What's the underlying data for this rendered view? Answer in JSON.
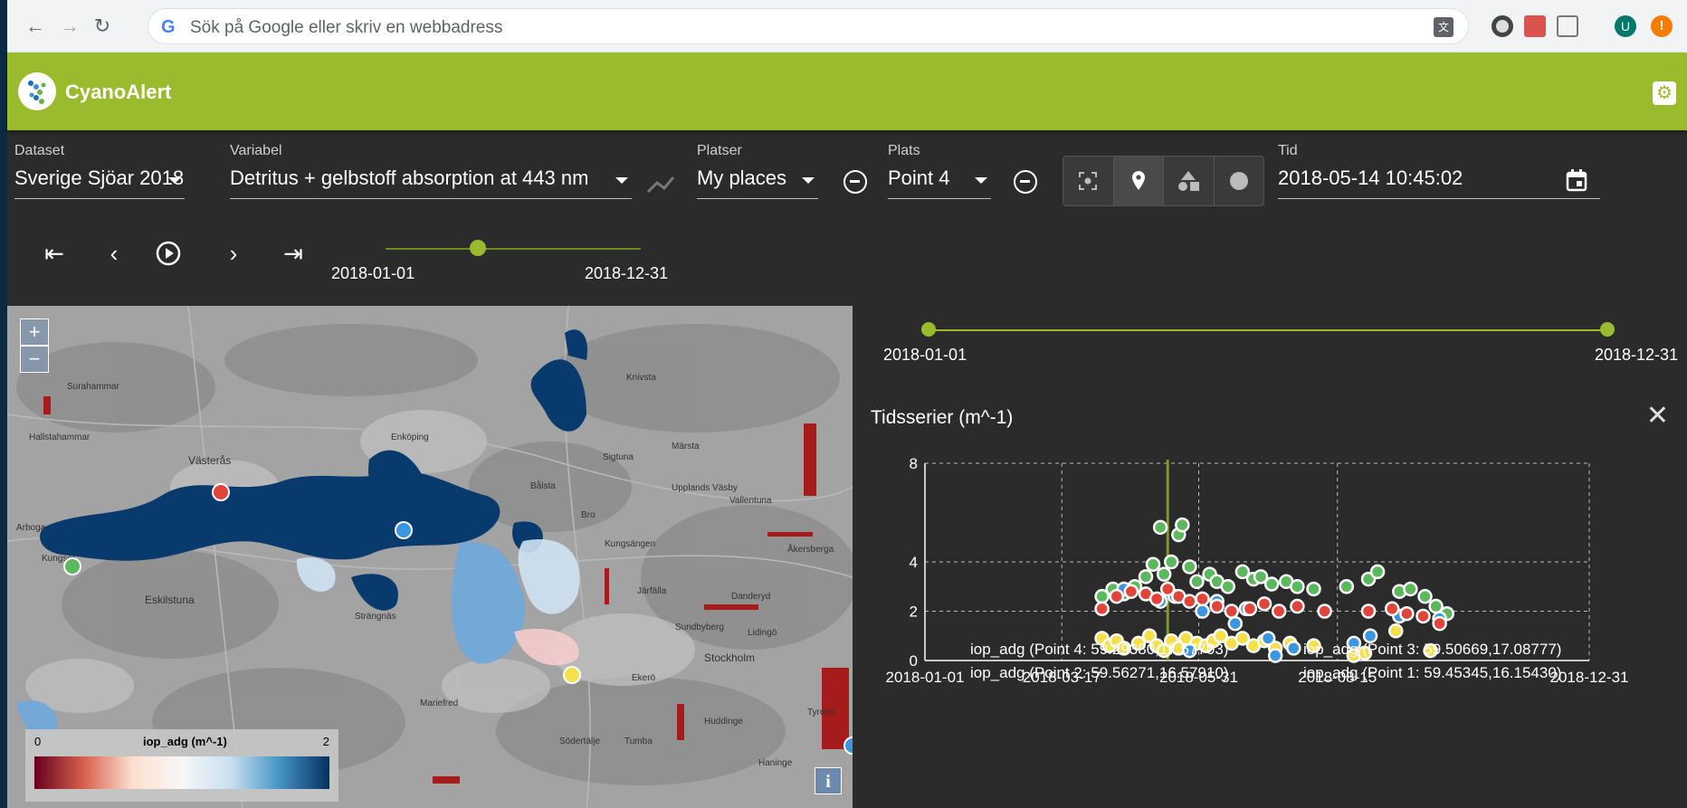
{
  "browser": {
    "omnibox_placeholder": "Sök på Google eller skriv en webbadress",
    "avatar_letter": "U"
  },
  "app": {
    "title": "CyanoAlert"
  },
  "controls": {
    "dataset": {
      "label": "Dataset",
      "value": "Sverige Sjöar 2018"
    },
    "variable": {
      "label": "Variabel",
      "value": "Detritus + gelbstoff absorption at 443 nm"
    },
    "places": {
      "label": "Platser",
      "value": "My places"
    },
    "place": {
      "label": "Plats",
      "value": "Point 4"
    },
    "time": {
      "label": "Tid",
      "value": "2018-05-14 10:45:02"
    },
    "toggle_icons": [
      "focus-icon",
      "pin-icon",
      "shapes-icon",
      "circle-icon"
    ]
  },
  "playback": {
    "start": "2018-01-01",
    "end": "2018-12-31",
    "position": 0.37
  },
  "map": {
    "places": [
      "Surahammar",
      "Hallstahammar",
      "Västerås",
      "Enköping",
      "Knivsta",
      "Märsta",
      "Sigtuna",
      "Bålsta",
      "Upplands Väsby",
      "Vallentuna",
      "Bro",
      "Kungsängen",
      "Järfälla",
      "Danderyd",
      "Åkersberga",
      "Kungsör",
      "Eskilstuna",
      "Strängnäs",
      "Sundbyberg",
      "Lidingö",
      "Stockholm",
      "Ekerö",
      "Mariefred",
      "Huddinge",
      "Tyresö",
      "Södertälje",
      "Tumba",
      "Haninge",
      "Arboga"
    ],
    "legend": {
      "min": "0",
      "max": "2",
      "name": "iop_adg (m^-1)"
    },
    "zoom_in": "+",
    "zoom_out": "−",
    "info": "i"
  },
  "range": {
    "start": "2018-01-01",
    "end": "2018-12-31"
  },
  "chart_data": {
    "type": "scatter",
    "title": "Tidsserier (m^-1)",
    "x_ticks": [
      "2018-01-01",
      "2018-03-17",
      "2018-05-31",
      "2018-08-15",
      "2018-12-31"
    ],
    "y_ticks": [
      "0",
      "2",
      "4",
      "8"
    ],
    "xlim": [
      "2018-01-01",
      "2018-12-31"
    ],
    "ylim": [
      0,
      8
    ],
    "marker_date": "2018-05-14",
    "grid": true,
    "series": [
      {
        "name": "iop_adg (Point 4: 59.29380,17.57703)",
        "color": "#f5e04a",
        "points": [
          [
            "2018-04-08",
            0.9
          ],
          [
            "2018-04-12",
            0.6
          ],
          [
            "2018-04-16",
            0.8
          ],
          [
            "2018-04-20",
            0.5
          ],
          [
            "2018-04-28",
            0.7
          ],
          [
            "2018-05-04",
            1.0
          ],
          [
            "2018-05-08",
            0.6
          ],
          [
            "2018-05-12",
            0.4
          ],
          [
            "2018-05-16",
            0.8
          ],
          [
            "2018-05-20",
            0.5
          ],
          [
            "2018-05-24",
            0.9
          ],
          [
            "2018-05-30",
            0.7
          ],
          [
            "2018-06-04",
            0.6
          ],
          [
            "2018-06-08",
            0.8
          ],
          [
            "2018-06-12",
            1.0
          ],
          [
            "2018-06-18",
            0.7
          ],
          [
            "2018-06-24",
            0.9
          ],
          [
            "2018-06-30",
            0.6
          ],
          [
            "2018-07-06",
            0.8
          ],
          [
            "2018-07-12",
            0.5
          ],
          [
            "2018-07-20",
            0.7
          ],
          [
            "2018-08-02",
            0.6
          ],
          [
            "2018-08-24",
            0.2
          ],
          [
            "2018-08-30",
            0.3
          ],
          [
            "2018-09-16",
            1.2
          ],
          [
            "2018-10-05",
            0.4
          ]
        ]
      },
      {
        "name": "iop_adg (Point 3: 59.50669,17.08777)",
        "color": "#5cb85c",
        "points": [
          [
            "2018-04-08",
            2.6
          ],
          [
            "2018-04-14",
            2.9
          ],
          [
            "2018-04-20",
            2.7
          ],
          [
            "2018-04-26",
            3.0
          ],
          [
            "2018-05-02",
            3.4
          ],
          [
            "2018-05-06",
            3.9
          ],
          [
            "2018-05-10",
            5.4
          ],
          [
            "2018-05-12",
            3.5
          ],
          [
            "2018-05-16",
            4.0
          ],
          [
            "2018-05-20",
            5.1
          ],
          [
            "2018-05-22",
            5.5
          ],
          [
            "2018-05-26",
            3.8
          ],
          [
            "2018-05-30",
            3.2
          ],
          [
            "2018-06-06",
            3.5
          ],
          [
            "2018-06-10",
            3.2
          ],
          [
            "2018-06-16",
            3.0
          ],
          [
            "2018-06-24",
            3.6
          ],
          [
            "2018-06-30",
            3.3
          ],
          [
            "2018-07-04",
            3.4
          ],
          [
            "2018-07-10",
            3.1
          ],
          [
            "2018-07-18",
            3.2
          ],
          [
            "2018-07-24",
            3.0
          ],
          [
            "2018-08-02",
            2.9
          ],
          [
            "2018-08-20",
            3.0
          ],
          [
            "2018-09-01",
            3.3
          ],
          [
            "2018-09-06",
            3.6
          ],
          [
            "2018-09-18",
            2.8
          ],
          [
            "2018-09-24",
            2.9
          ],
          [
            "2018-10-02",
            2.6
          ],
          [
            "2018-10-08",
            2.2
          ],
          [
            "2018-10-14",
            1.9
          ]
        ]
      },
      {
        "name": "iop_adg (Point 2: 59.56271,16.57910)",
        "color": "#3a96e0",
        "points": [
          [
            "2018-04-20",
            2.9
          ],
          [
            "2018-05-10",
            2.4
          ],
          [
            "2018-05-18",
            2.6
          ],
          [
            "2018-05-26",
            0.4
          ],
          [
            "2018-06-02",
            2.0
          ],
          [
            "2018-06-10",
            2.4
          ],
          [
            "2018-06-20",
            1.5
          ],
          [
            "2018-06-26",
            2.1
          ],
          [
            "2018-07-08",
            0.9
          ],
          [
            "2018-07-12",
            0.2
          ],
          [
            "2018-07-22",
            0.5
          ],
          [
            "2018-08-24",
            0.7
          ],
          [
            "2018-09-02",
            1.0
          ],
          [
            "2018-09-18",
            1.8
          ],
          [
            "2018-10-10",
            1.7
          ]
        ]
      },
      {
        "name": "iop_adg (Point 1: 59.45345,16.15430)",
        "color": "#e0443a",
        "points": [
          [
            "2018-04-08",
            2.1
          ],
          [
            "2018-04-16",
            2.6
          ],
          [
            "2018-04-24",
            2.8
          ],
          [
            "2018-05-02",
            2.7
          ],
          [
            "2018-05-08",
            2.5
          ],
          [
            "2018-05-14",
            2.9
          ],
          [
            "2018-05-20",
            2.6
          ],
          [
            "2018-05-26",
            2.4
          ],
          [
            "2018-06-02",
            2.5
          ],
          [
            "2018-06-10",
            2.2
          ],
          [
            "2018-06-18",
            2.0
          ],
          [
            "2018-06-28",
            2.1
          ],
          [
            "2018-07-06",
            2.3
          ],
          [
            "2018-07-14",
            2.0
          ],
          [
            "2018-07-24",
            2.2
          ],
          [
            "2018-08-08",
            2.0
          ],
          [
            "2018-09-01",
            2.0
          ],
          [
            "2018-09-14",
            2.1
          ],
          [
            "2018-09-22",
            1.9
          ],
          [
            "2018-10-01",
            1.8
          ],
          [
            "2018-10-10",
            1.5
          ]
        ]
      }
    ]
  }
}
